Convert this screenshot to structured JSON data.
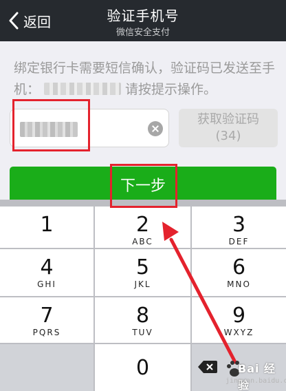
{
  "navbar": {
    "back_label": "返回",
    "title": "验证手机号",
    "subtitle": "微信安全支付"
  },
  "instruction": {
    "text_before": "绑定银行卡需要短信确认，验证码已发送至手机：",
    "text_after": "请按提示操作。"
  },
  "get_code": {
    "label": "获取验证码",
    "countdown": "(34)"
  },
  "next_button": {
    "label": "下一步"
  },
  "keypad": {
    "keys": [
      {
        "digit": "1",
        "letters": ""
      },
      {
        "digit": "2",
        "letters": "ABC"
      },
      {
        "digit": "3",
        "letters": "DEF"
      },
      {
        "digit": "4",
        "letters": "GHI"
      },
      {
        "digit": "5",
        "letters": "JKL"
      },
      {
        "digit": "6",
        "letters": "MNO"
      },
      {
        "digit": "7",
        "letters": "PQRS"
      },
      {
        "digit": "8",
        "letters": "TUV"
      },
      {
        "digit": "9",
        "letters": "WXYZ"
      },
      {
        "digit": "0",
        "letters": ""
      }
    ]
  },
  "watermark": {
    "brand": "Bai 经验",
    "site": "jingyan.baidu.com"
  },
  "colors": {
    "navbar": "#262a2f",
    "accent_green": "#1aad19",
    "annotation_red": "#e4222d"
  }
}
